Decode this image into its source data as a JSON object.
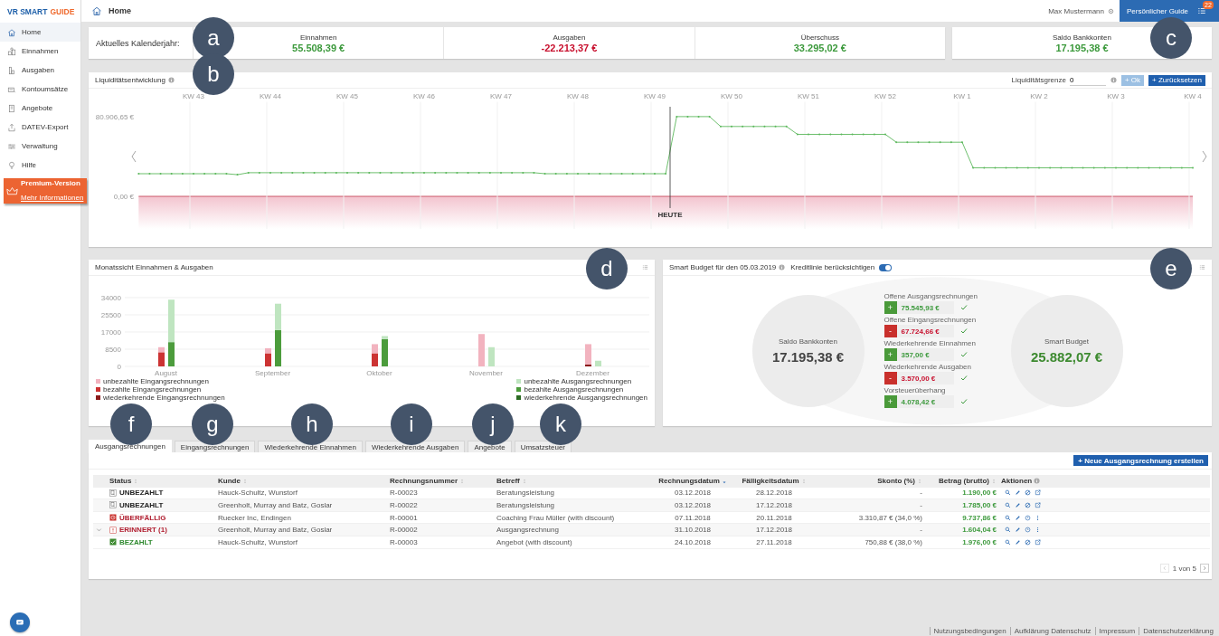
{
  "logo": {
    "primary": "VR SMART",
    "accent": "GUIDE"
  },
  "sidebar": {
    "items": [
      {
        "label": "Home",
        "selected": true
      },
      {
        "label": "Einnahmen",
        "selected": false
      },
      {
        "label": "Ausgaben",
        "selected": false
      },
      {
        "label": "Kontoumsätze",
        "selected": false
      },
      {
        "label": "Angebote",
        "selected": false
      },
      {
        "label": "DATEV-Export",
        "selected": false
      },
      {
        "label": "Verwaltung",
        "selected": false
      },
      {
        "label": "Hilfe",
        "selected": false
      }
    ]
  },
  "premium": {
    "title": "Premium-Version",
    "link": "Mehr Informationen"
  },
  "topbar": {
    "page_title": "Home",
    "user": "Max Mustermann",
    "guide_button": "Persönlicher Guide",
    "guide_badge": "22"
  },
  "callouts": [
    "a",
    "b",
    "c",
    "d",
    "e",
    "f",
    "g",
    "h",
    "i",
    "j",
    "k"
  ],
  "summary": {
    "label": "Aktuelles Kalenderjahr:",
    "stats": [
      {
        "label": "Einnahmen",
        "value": "55.508,39 €",
        "kind": "positive"
      },
      {
        "label": "Ausgaben",
        "value": "-22.213,37 €",
        "kind": "negative"
      },
      {
        "label": "Überschuss",
        "value": "33.295,02 €",
        "kind": "positive"
      }
    ],
    "bank": {
      "label": "Saldo Bankkonten",
      "value": "17.195,38 €"
    }
  },
  "liquidity": {
    "title": "Liquiditätsentwicklung",
    "limit_field": {
      "label": "Liquiditätsgrenze",
      "value": "0"
    },
    "buttons": [
      {
        "label": "+ Ok",
        "disabled": true
      },
      {
        "label": "+ Zurücksetzen",
        "disabled": false
      }
    ],
    "chart_data": {
      "type": "line",
      "grid": true,
      "ylim": [
        -33000,
        96000
      ],
      "categories": [
        null,
        null,
        null,
        null,
        null,
        "KW 43",
        null,
        null,
        null,
        null,
        null,
        null,
        "KW 44",
        null,
        null,
        null,
        null,
        null,
        null,
        "KW 45",
        null,
        null,
        null,
        null,
        null,
        null,
        "KW 46",
        null,
        null,
        null,
        null,
        null,
        null,
        "KW 47",
        null,
        null,
        null,
        null,
        null,
        null,
        "KW 48",
        null,
        null,
        null,
        null,
        null,
        null,
        "KW 49",
        null,
        null,
        null,
        null,
        null,
        null,
        "KW 50",
        null,
        null,
        null,
        null,
        null,
        null,
        "KW 51",
        null,
        null,
        null,
        null,
        null,
        null,
        "KW 52",
        null,
        null,
        null,
        null,
        null,
        null,
        "KW 1",
        null,
        null,
        null,
        null,
        null,
        null,
        "KW 2",
        null,
        null,
        null,
        null,
        null,
        null,
        "KW 3",
        null,
        null,
        null,
        null,
        null,
        null,
        "KW 4"
      ],
      "series": [
        {
          "color": "#5cb85c",
          "values": [
            23000,
            23000,
            23000,
            23000,
            23000,
            23000,
            23000,
            23000,
            23000,
            22000,
            24000,
            24000,
            24000,
            24000,
            24000,
            24000,
            24000,
            24000,
            24000,
            24000,
            24000,
            24000,
            24000,
            24000,
            24000,
            24000,
            24000,
            24000,
            24000,
            24000,
            24000,
            24000,
            24000,
            24000,
            24000,
            24000,
            24000,
            23000,
            23000,
            23000,
            23000,
            23000,
            23000,
            23000,
            23000,
            23000,
            23000,
            23000,
            23000,
            81000,
            81000,
            81000,
            81000,
            71000,
            71000,
            71000,
            71000,
            71000,
            71000,
            71000,
            63000,
            63000,
            63000,
            63000,
            63000,
            63000,
            63000,
            63000,
            63000,
            55000,
            55000,
            55000,
            55000,
            55000,
            55000,
            55000,
            29000,
            29000,
            29000,
            29000,
            29000,
            29000,
            29000,
            29000,
            29000,
            29000,
            29000,
            29000,
            29000,
            29000,
            29000,
            29000,
            29000,
            29000,
            29000,
            29000,
            29000
          ]
        }
      ],
      "yticks": [
        {
          "value": 0,
          "label": "0,00 €"
        },
        {
          "value": 80906.65,
          "label": "80.906,65 €"
        }
      ],
      "annotations": [
        "HEUTE"
      ]
    }
  },
  "monthly": {
    "title": "Monatssicht Einnahmen & Ausgaben",
    "incoming": {
      "chart_data": {
        "type": "bar",
        "stacked": true,
        "grid": true,
        "categories": [
          "August",
          "September",
          "Oktober",
          "November",
          "Dezember"
        ],
        "ylim": [
          0,
          34000
        ],
        "yticks": [
          0,
          8500,
          17000,
          25500,
          34000
        ],
        "series": [
          {
            "name": "unbezahlte Eingangsrechnungen",
            "color": "#f2b3bf",
            "values": [
              2500,
              2500,
              4500,
              16000,
              10000
            ]
          },
          {
            "name": "bezahlte Eingangsrechnungen",
            "color": "#cc3333",
            "values": [
              7000,
              6500,
              6500,
              0,
              0
            ]
          },
          {
            "name": "wiederkehrende Eingangsrechnungen",
            "color": "#8b1a1a",
            "values": [
              0,
              0,
              0,
              0,
              1000
            ]
          }
        ]
      }
    },
    "outgoing": {
      "chart_data": {
        "type": "bar",
        "stacked": true,
        "ylim": [
          0,
          34000
        ],
        "series": [
          {
            "name": "unbezahlte Ausgangsrechnungen",
            "color": "#bfe5c0",
            "values": [
              21000,
              13000,
              1500,
              9500,
              2800
            ]
          },
          {
            "name": "bezahlte Ausgangsrechnungen",
            "color": "#4c9c3c",
            "values": [
              12000,
              18000,
              13500,
              0,
              0
            ]
          },
          {
            "name": "wiederkehrende Ausgangsrechnungen",
            "color": "#2b6a22",
            "values": [
              0,
              0,
              0,
              0,
              0
            ]
          }
        ]
      }
    }
  },
  "smart_budget": {
    "title": "Smart Budget für den 05.03.2019",
    "toggle": {
      "label": "Kreditlinie berücksichtigen",
      "on": true
    },
    "balance": {
      "label": "Saldo Bankkonten",
      "value": "17.195,38 €"
    },
    "items": [
      {
        "label": "Offene Ausgangsrechnungen",
        "kind": "plus",
        "sign": "+",
        "amount": "75.545,93 €",
        "checked": true
      },
      {
        "label": "Offene Eingangsrechnungen",
        "kind": "minus",
        "sign": "-",
        "amount": "67.724,66 €",
        "checked": true
      },
      {
        "label": "Wiederkehrende Einnahmen",
        "kind": "plus",
        "sign": "+",
        "amount": "357,00 €",
        "checked": true
      },
      {
        "label": "Wiederkehrende Ausgaben",
        "kind": "minus",
        "sign": "-",
        "amount": "3.570,00 €",
        "checked": true
      },
      {
        "label": "Vorsteuerüberhang",
        "kind": "plus",
        "sign": "+",
        "amount": "4.078,42 €",
        "checked": true
      }
    ],
    "result": {
      "label": "Smart Budget",
      "value": "25.882,07 €"
    }
  },
  "tabs": [
    {
      "label": "Ausgangsrechnungen",
      "selected": true
    },
    {
      "label": "Eingangsrechnungen",
      "selected": false
    },
    {
      "label": "Wiederkehrende Einnahmen",
      "selected": false
    },
    {
      "label": "Wiederkehrende Ausgaben",
      "selected": false
    },
    {
      "label": "Angebote",
      "selected": false
    },
    {
      "label": "Umsatzsteuer",
      "selected": false
    }
  ],
  "invoices": {
    "new_button": "+ Neue Ausgangsrechnung erstellen",
    "columns": [
      {
        "label": "Status",
        "sortable": true,
        "sorted": false
      },
      {
        "label": "Kunde",
        "sortable": true,
        "sorted": false
      },
      {
        "label": "Rechnungsnummer",
        "sortable": true,
        "sorted": false
      },
      {
        "label": "Betreff",
        "sortable": true,
        "sorted": false
      },
      {
        "label": "Rechnungsdatum",
        "sortable": true,
        "sorted": true
      },
      {
        "label": "Fälligkeitsdatum",
        "sortable": true,
        "sorted": false
      },
      {
        "label": "Skonto (%)",
        "sortable": true,
        "sorted": false
      },
      {
        "label": "Betrag (brutto)",
        "sortable": true,
        "sorted": false
      },
      {
        "label": "Aktionen",
        "sortable": false
      }
    ],
    "rows": [
      {
        "expandable": false,
        "status": "UNBEZAHLT",
        "kind": "unpaid",
        "customer": "Hauck-Schultz, Wunstorf",
        "number": "R-00023",
        "subject": "Beratungsleistung",
        "date": "03.12.2018",
        "due": "28.12.2018",
        "discount": "-",
        "amount": "1.190,00 €",
        "actions": [
          {
            "kind": "view"
          },
          {
            "kind": "edit"
          },
          {
            "kind": "cancel"
          },
          {
            "kind": "share"
          }
        ]
      },
      {
        "expandable": false,
        "status": "UNBEZAHLT",
        "kind": "unpaid",
        "customer": "Greenholt, Murray and Batz, Goslar",
        "number": "R-00022",
        "subject": "Beratungsleistung",
        "date": "03.12.2018",
        "due": "17.12.2018",
        "discount": "-",
        "amount": "1.785,00 €",
        "actions": [
          {
            "kind": "view"
          },
          {
            "kind": "edit"
          },
          {
            "kind": "cancel"
          },
          {
            "kind": "share"
          }
        ]
      },
      {
        "expandable": false,
        "status": "ÜBERFÄLLIG",
        "kind": "overdue",
        "customer": "Ruecker Inc, Endingen",
        "number": "R-00001",
        "subject": "Coaching Frau Müller (with discount)",
        "date": "07.11.2018",
        "due": "20.11.2018",
        "discount": "3.310,87 € (34,0 %)",
        "amount": "9.737,86 €",
        "actions": [
          {
            "kind": "view"
          },
          {
            "kind": "edit"
          },
          {
            "kind": "remind"
          },
          {
            "kind": "more"
          }
        ]
      },
      {
        "expandable": true,
        "status": "ERINNERT (1)",
        "kind": "reminded",
        "customer": "Greenholt, Murray and Batz, Goslar",
        "number": "R-00002",
        "subject": "Ausgangsrechnung",
        "date": "31.10.2018",
        "due": "17.12.2018",
        "discount": "-",
        "amount": "1.604,04 €",
        "actions": [
          {
            "kind": "view"
          },
          {
            "kind": "edit"
          },
          {
            "kind": "remind"
          },
          {
            "kind": "more"
          }
        ]
      },
      {
        "expandable": false,
        "status": "BEZAHLT",
        "kind": "paid",
        "customer": "Hauck-Schultz, Wunstorf",
        "number": "R-00003",
        "subject": "Angebot (with discount)",
        "date": "24.10.2018",
        "due": "27.11.2018",
        "discount": "750,88 € (38,0 %)",
        "amount": "1.976,00 €",
        "actions": [
          {
            "kind": "view"
          },
          {
            "kind": "edit"
          },
          {
            "kind": "cancel"
          },
          {
            "kind": "share"
          }
        ]
      }
    ],
    "pagination": {
      "text": "1 von 5",
      "prev_disabled": true,
      "next_disabled": false
    }
  },
  "footer": {
    "links": [
      "Nutzungsbedingungen",
      "Aufklärung Datenschutz",
      "Impressum",
      "Datenschutzerklärung"
    ]
  }
}
